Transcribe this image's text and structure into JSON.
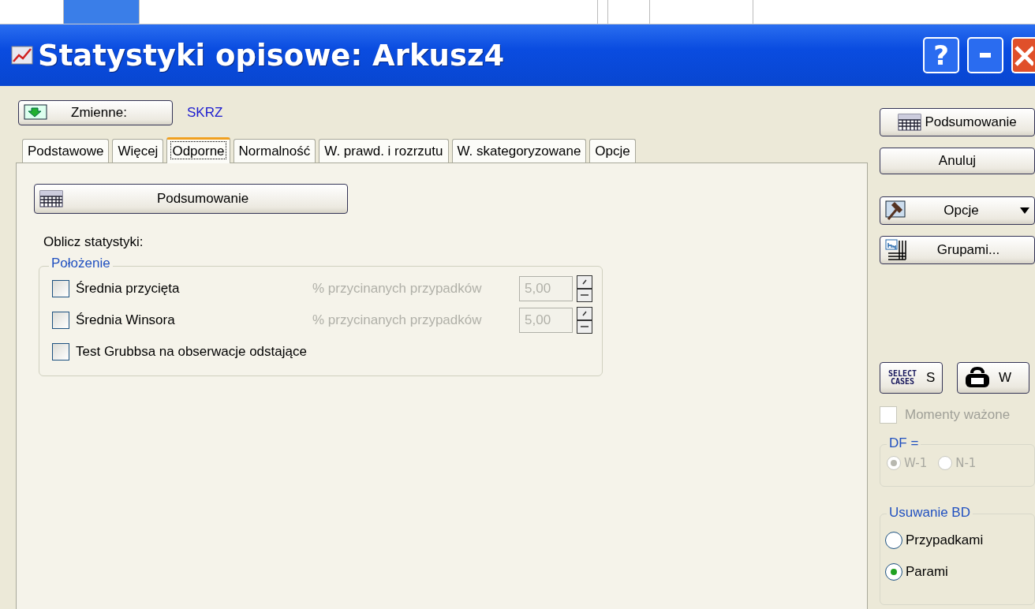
{
  "window": {
    "title": "Statystyki opisowe: Arkusz4",
    "buttons": [
      {
        "kind": "help",
        "label": "?"
      },
      {
        "kind": "minimize"
      },
      {
        "kind": "close"
      }
    ]
  },
  "variables": {
    "button": "Zmienne:",
    "value": "SKRZ"
  },
  "tabs": [
    {
      "label": "Podstawowe",
      "selected": false
    },
    {
      "label": "Więcej",
      "selected": false
    },
    {
      "label": "Odporne",
      "selected": true
    },
    {
      "label": "Normalność",
      "selected": false
    },
    {
      "label": "W. prawd. i rozrzutu",
      "selected": false
    },
    {
      "label": "W. skategoryzowane",
      "selected": false
    },
    {
      "label": "Opcje",
      "selected": false
    }
  ],
  "panel": {
    "summary_button": "Podsumowanie",
    "heading": "Oblicz statystyki:",
    "group": {
      "title": "Położenie",
      "rows": [
        {
          "label": "Średnia przycięta",
          "checked": false,
          "param_label": "% przycinanych przypadków",
          "value": "5,00",
          "disabled": true
        },
        {
          "label": "Średnia Winsora",
          "checked": false,
          "param_label": "% przycinanych przypadków",
          "value": "5,00",
          "disabled": true
        },
        {
          "label": "Test Grubbsa na obserwacje odstające",
          "checked": false
        }
      ]
    }
  },
  "side": {
    "buttons": [
      {
        "kind": "summary",
        "label": "Podsumowanie"
      },
      {
        "kind": "plain",
        "label": "Anuluj"
      },
      {
        "kind": "options",
        "label": "Opcje"
      },
      {
        "kind": "groups",
        "label": "Grupami..."
      }
    ],
    "select_cases": {
      "icon_text": "SELECT CASES",
      "label": "S"
    },
    "weight": {
      "label": "W"
    },
    "weighted_moments": {
      "label": "Momenty ważone",
      "checked": false,
      "disabled": true
    },
    "df": {
      "title": "DF =",
      "disabled": true,
      "options": [
        {
          "label": "W-1",
          "selected": true
        },
        {
          "label": "N-1",
          "selected": false
        }
      ]
    },
    "missing": {
      "title": "Usuwanie BD",
      "options": [
        {
          "label": "Przypadkami",
          "selected": false
        },
        {
          "label": "Parami",
          "selected": true
        }
      ]
    }
  }
}
